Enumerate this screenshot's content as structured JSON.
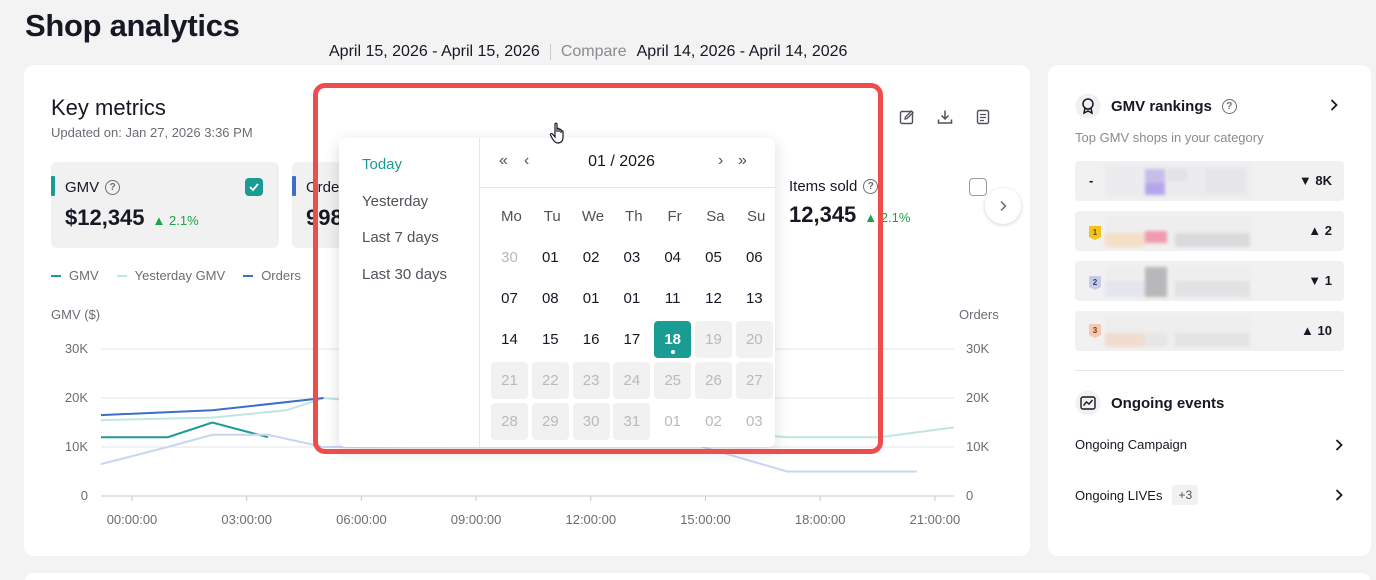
{
  "page": {
    "title": "Shop analytics"
  },
  "key_metrics": {
    "title": "Key metrics",
    "updated": "Updated on: Jan 27, 2026 3:36 PM",
    "date_range": "April 15, 2026 - April 15, 2026",
    "compare_label": "Compare",
    "compare_range": "April 14, 2026 - April 14, 2026",
    "toolbar_icons": [
      "edit-icon",
      "download-icon",
      "report-icon"
    ],
    "metrics": [
      {
        "label": "GMV",
        "value": "$12,345",
        "change": "▲ 2.1%",
        "checked": true,
        "color": "#1a9c95"
      },
      {
        "label": "Orde",
        "value": "998",
        "color": "#3d6fc6"
      },
      {
        "label": "Items sold",
        "value": "12,345",
        "change": "▲ 2.1%",
        "checked": false
      }
    ],
    "legend": [
      {
        "label": "GMV",
        "color": "#1a9c95"
      },
      {
        "label": "Yesterday GMV",
        "color": "#bfe6e2"
      },
      {
        "label": "Orders",
        "color": "#3d6fc6"
      }
    ]
  },
  "chart_data": {
    "type": "line",
    "y_left_label": "GMV ($)",
    "y_right_label": "Orders",
    "y_ticks_left": [
      "30K",
      "20K",
      "10K",
      "0"
    ],
    "y_ticks_right": [
      "30K",
      "20K",
      "10K",
      "0"
    ],
    "x_ticks": [
      "00:00:00",
      "03:00:00",
      "06:00:00",
      "09:00:00",
      "12:00:00",
      "15:00:00",
      "18:00:00",
      "21:00:00"
    ],
    "ylim": [
      0,
      30000
    ],
    "series": [
      {
        "name": "GMV",
        "color": "#1a9c95",
        "points": [
          [
            0,
            12000
          ],
          [
            1.8,
            12000
          ],
          [
            3,
            15000
          ],
          [
            4.5,
            12000
          ]
        ]
      },
      {
        "name": "Yesterday GMV",
        "color": "#bfe6e2",
        "points": [
          [
            0,
            15500
          ],
          [
            3,
            16000
          ],
          [
            5,
            17500
          ],
          [
            6,
            20000
          ],
          [
            18.5,
            12000
          ],
          [
            21,
            12000
          ],
          [
            23,
            14000
          ]
        ]
      },
      {
        "name": "Orders",
        "color": "#3d6fc6",
        "points": [
          [
            0,
            16500
          ],
          [
            3,
            17500
          ],
          [
            6,
            20000
          ]
        ]
      },
      {
        "name": "Orders (prev)",
        "color": "#c9d6f0",
        "points": [
          [
            0,
            6500
          ],
          [
            1.8,
            10000
          ],
          [
            3,
            12500
          ],
          [
            4.5,
            12500
          ],
          [
            6,
            10000
          ],
          [
            16,
            10500
          ],
          [
            18.5,
            5000
          ],
          [
            22,
            5000
          ]
        ]
      }
    ]
  },
  "date_picker": {
    "presets": [
      "Today",
      "Yesterday",
      "Last 7 days",
      "Last 30 days"
    ],
    "active_preset": "Today",
    "month_label": "01 / 2026",
    "weekdays": [
      "Mo",
      "Tu",
      "We",
      "Th",
      "Fr",
      "Sa",
      "Su"
    ],
    "weeks": [
      [
        [
          "30",
          "muted"
        ],
        [
          "01",
          ""
        ],
        [
          "02",
          ""
        ],
        [
          "03",
          ""
        ],
        [
          "04",
          ""
        ],
        [
          "05",
          ""
        ],
        [
          "06",
          ""
        ]
      ],
      [
        [
          "07",
          ""
        ],
        [
          "08",
          ""
        ],
        [
          "01",
          ""
        ],
        [
          "01",
          ""
        ],
        [
          "11",
          ""
        ],
        [
          "12",
          ""
        ],
        [
          "13",
          ""
        ]
      ],
      [
        [
          "14",
          ""
        ],
        [
          "15",
          ""
        ],
        [
          "16",
          ""
        ],
        [
          "17",
          ""
        ],
        [
          "18",
          "selected"
        ],
        [
          "19",
          "disabled"
        ],
        [
          "20",
          "disabled"
        ]
      ],
      [
        [
          "21",
          "disabled"
        ],
        [
          "22",
          "disabled"
        ],
        [
          "23",
          "disabled"
        ],
        [
          "24",
          "disabled"
        ],
        [
          "25",
          "disabled"
        ],
        [
          "26",
          "disabled"
        ],
        [
          "27",
          "disabled"
        ]
      ],
      [
        [
          "28",
          "disabled"
        ],
        [
          "29",
          "disabled"
        ],
        [
          "30",
          "disabled"
        ],
        [
          "31",
          "disabled"
        ],
        [
          "01",
          "disabled-plain"
        ],
        [
          "02",
          "disabled-plain"
        ],
        [
          "03",
          "disabled-plain"
        ]
      ]
    ]
  },
  "gmv_rankings": {
    "title": "GMV rankings",
    "subtitle": "Top GMV shops in your category",
    "rows": [
      {
        "rank": "-",
        "trend": "▼ 8K"
      },
      {
        "rank": "1",
        "trend": "▲ 2"
      },
      {
        "rank": "2",
        "trend": "▼ 1"
      },
      {
        "rank": "3",
        "trend": "▲ 10"
      }
    ]
  },
  "ongoing_events": {
    "title": "Ongoing events",
    "items": [
      {
        "label": "Ongoing Campaign"
      },
      {
        "label": "Ongoing LIVEs",
        "badge": "+3"
      }
    ]
  }
}
